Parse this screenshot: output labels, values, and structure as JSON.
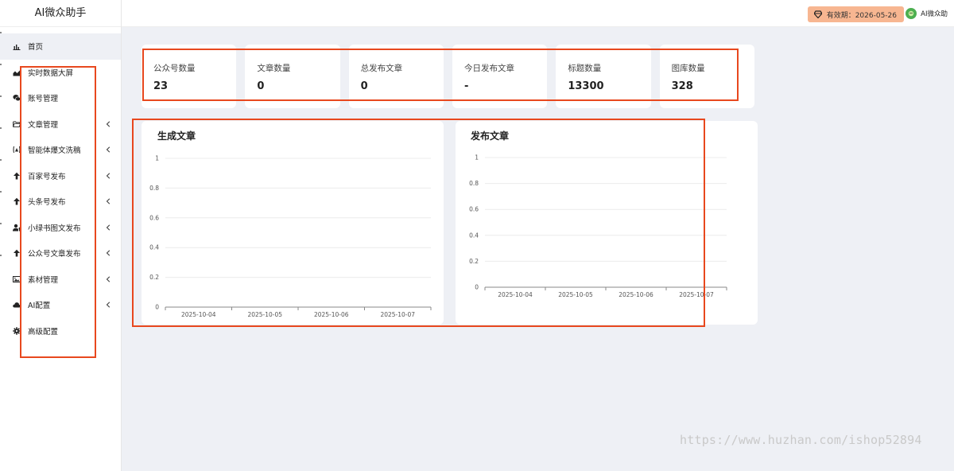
{
  "brand": {
    "title": "AI微众助手"
  },
  "sidebar": {
    "items": [
      {
        "label": "首页",
        "icon": "bar-chart-icon",
        "has_chevron": false,
        "active": true
      },
      {
        "label": "实时数据大屏",
        "icon": "area-chart-icon",
        "has_chevron": false
      },
      {
        "label": "账号管理",
        "icon": "wechat-icon",
        "has_chevron": false
      },
      {
        "label": "文章管理",
        "icon": "folder-open-icon",
        "has_chevron": true
      },
      {
        "label": "智能体爆文洗稿",
        "icon": "image-text-icon",
        "has_chevron": true
      },
      {
        "label": "百家号发布",
        "icon": "arrow-up-icon",
        "has_chevron": true
      },
      {
        "label": "头条号发布",
        "icon": "arrow-up-icon",
        "has_chevron": true
      },
      {
        "label": "小绿书图文发布",
        "icon": "user-upload-icon",
        "has_chevron": true
      },
      {
        "label": "公众号文章发布",
        "icon": "arrow-up-icon",
        "has_chevron": true
      },
      {
        "label": "素材管理",
        "icon": "picture-icon",
        "has_chevron": true
      },
      {
        "label": "AI配置",
        "icon": "cloud-icon",
        "has_chevron": true
      },
      {
        "label": "高级配置",
        "icon": "gear-icon",
        "has_chevron": false
      }
    ]
  },
  "topbar": {
    "expiry_label": "有效期：2026-05-26",
    "user_name": "AI微众助"
  },
  "stats": [
    {
      "label": "公众号数量",
      "value": "23"
    },
    {
      "label": "文章数量",
      "value": "0"
    },
    {
      "label": "总发布文章",
      "value": "0"
    },
    {
      "label": "今日发布文章",
      "value": "-"
    },
    {
      "label": "标题数量",
      "value": "13300"
    },
    {
      "label": "图库数量",
      "value": "328"
    }
  ],
  "chart_data": [
    {
      "type": "line",
      "title": "生成文章",
      "categories": [
        "2025-10-04",
        "2025-10-05",
        "2025-10-06",
        "2025-10-07"
      ],
      "series": [
        {
          "values": [
            0,
            0,
            0,
            0
          ]
        }
      ],
      "yticks": [
        "0",
        "0.2",
        "0.4",
        "0.6",
        "0.8",
        "1"
      ],
      "ylim": [
        0,
        1
      ],
      "grid": true
    },
    {
      "type": "line",
      "title": "发布文章",
      "categories": [
        "2025-10-04",
        "2025-10-05",
        "2025-10-06",
        "2025-10-07"
      ],
      "series": [
        {
          "values": [
            0,
            0,
            0,
            0
          ]
        }
      ],
      "yticks": [
        "0",
        "0.2",
        "0.4",
        "0.6",
        "0.8",
        "1"
      ],
      "ylim": [
        0,
        1
      ],
      "grid": true
    }
  ],
  "colors": {
    "accent": "#e8481e",
    "expiry_badge": "#f7b691",
    "page_bg": "#eef0f5"
  },
  "watermark": "https://www.huzhan.com/ishop52894"
}
